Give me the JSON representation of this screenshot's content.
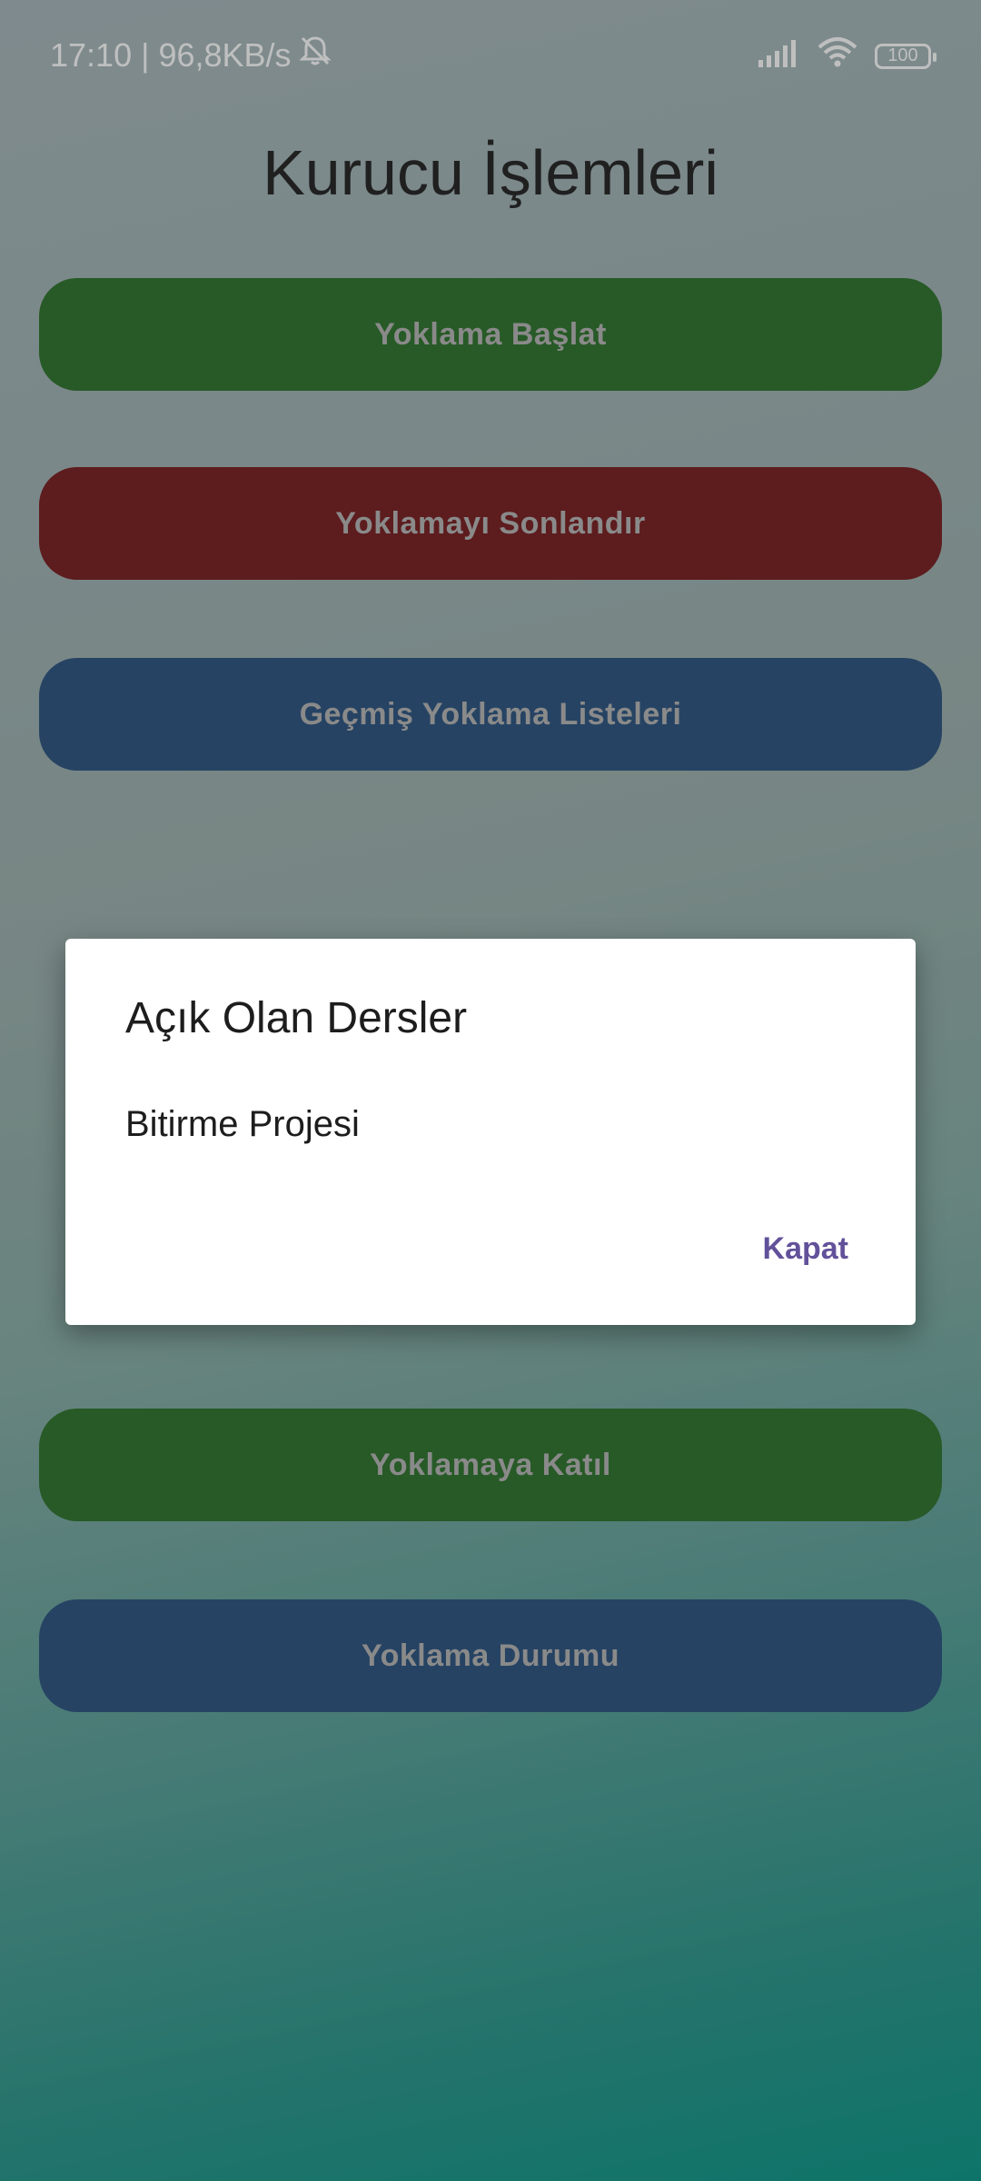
{
  "status_bar": {
    "time_speed": "17:10 | 96,8KB/s",
    "battery": "100",
    "icons": [
      "mute-notification-icon",
      "signal-icon",
      "wifi-icon",
      "battery-icon"
    ]
  },
  "page": {
    "title": "Kurucu İşlemleri"
  },
  "buttons": {
    "start": "Yoklama Başlat",
    "end": "Yoklamayı Sonlandır",
    "history": "Geçmiş Yoklama Listeleri",
    "join": "Yoklamaya Katıl",
    "status": "Yoklama Durumu"
  },
  "dialog": {
    "title": "Açık Olan Dersler",
    "course": "Bitirme Projesi",
    "close": "Kapat"
  },
  "colors": {
    "green": "#357835",
    "red": "#7d2628",
    "blue": "#335a85",
    "accent": "#62519a"
  }
}
